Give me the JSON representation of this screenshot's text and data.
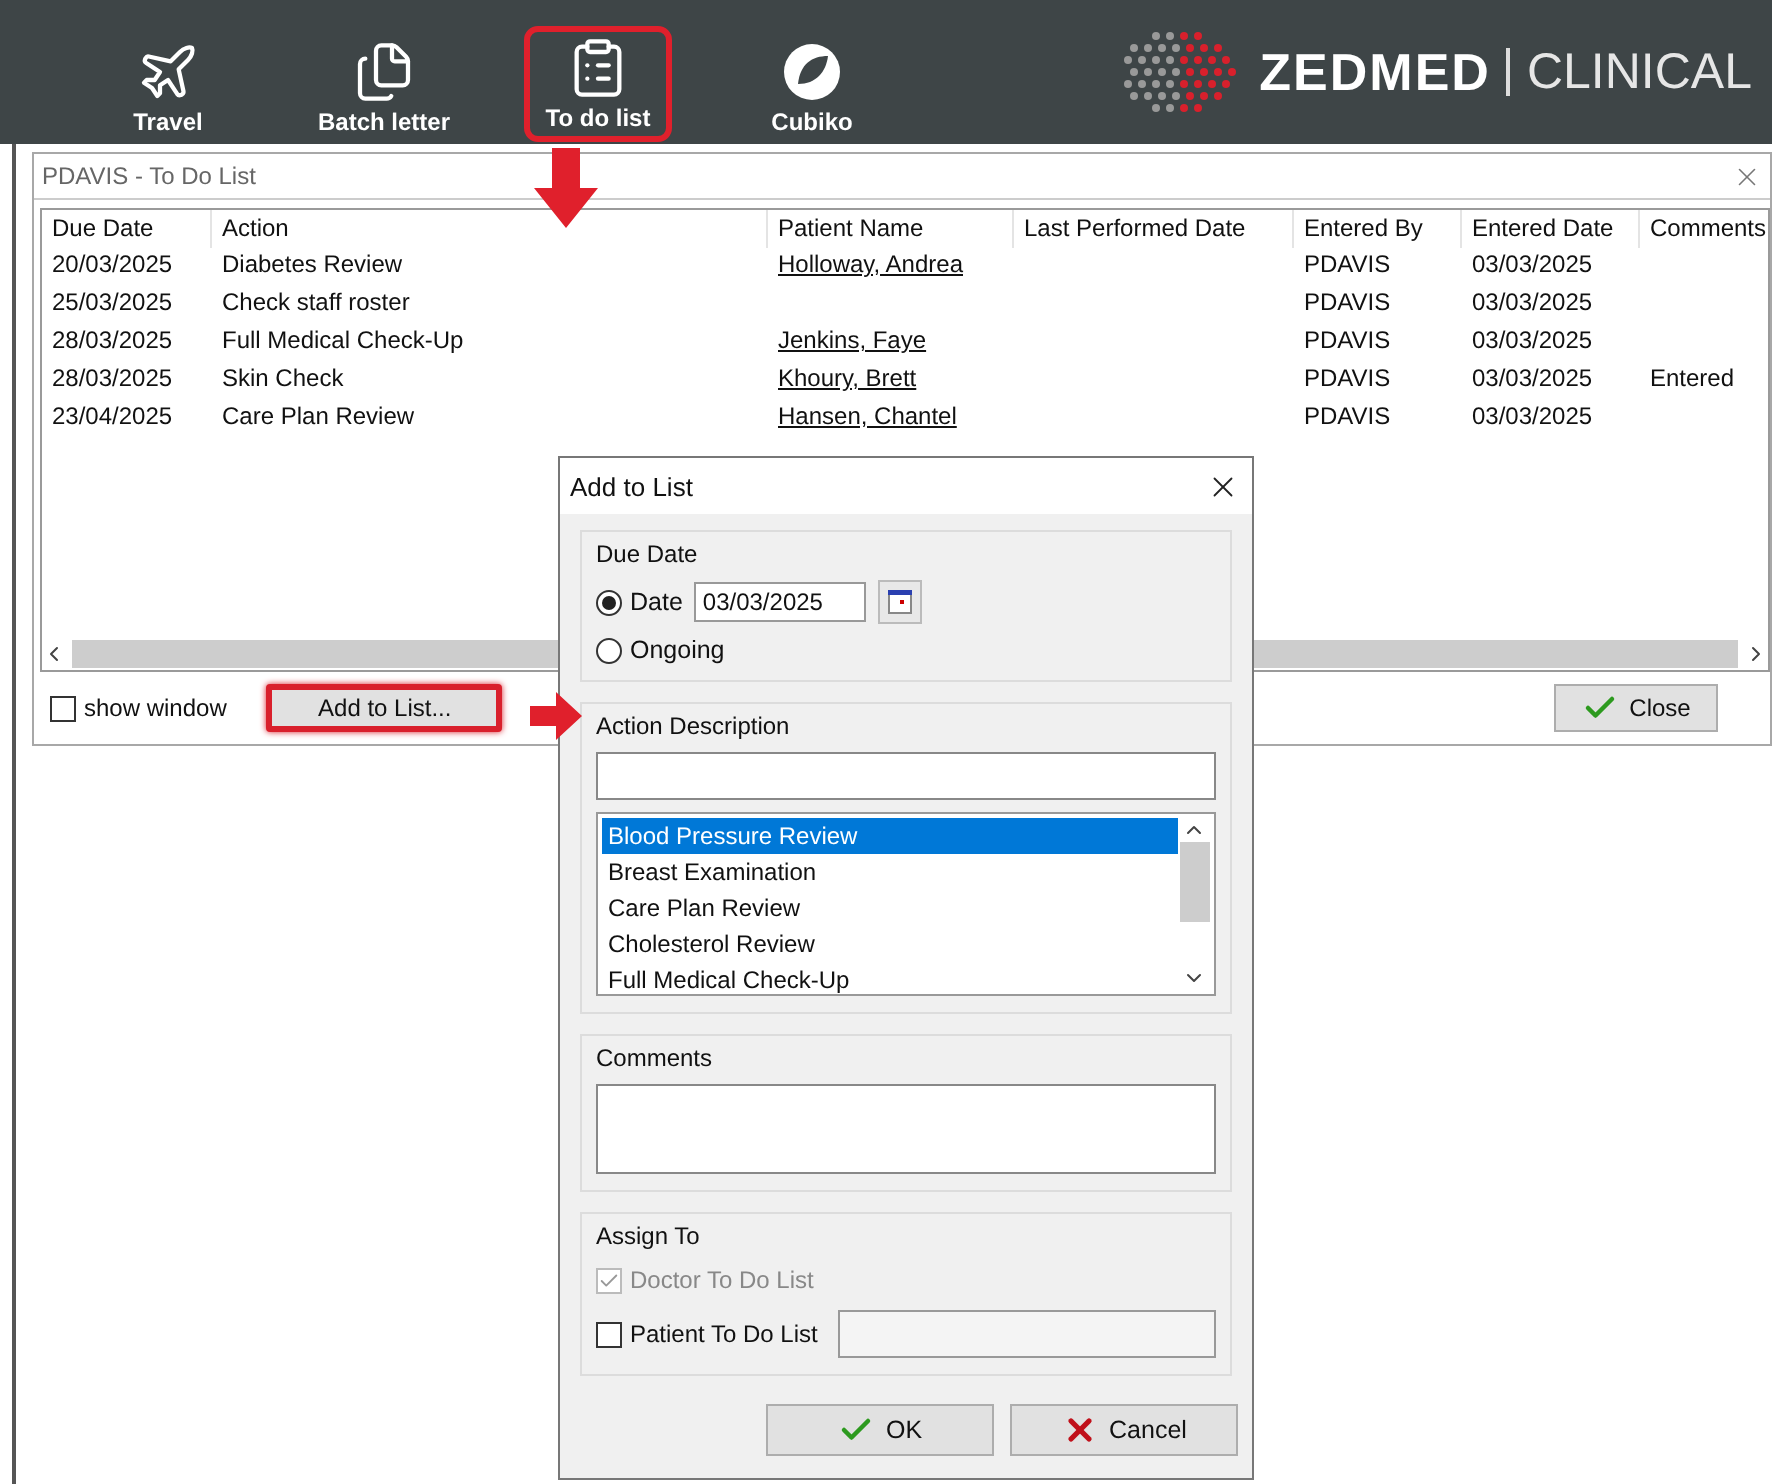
{
  "toolbar": {
    "buttons": [
      {
        "label": "Travel",
        "highlighted": false
      },
      {
        "label": "Batch letter",
        "highlighted": false
      },
      {
        "label": "To do list",
        "highlighted": true
      },
      {
        "label": "Cubiko",
        "highlighted": false
      }
    ],
    "logo": {
      "brand": "ZEDMED",
      "product": "CLINICAL"
    }
  },
  "window": {
    "title": "PDAVIS - To Do List"
  },
  "table": {
    "columns": [
      "Due Date",
      "Action",
      "Patient Name",
      "Last Performed Date",
      "Entered By",
      "Entered Date",
      "Comments"
    ],
    "rows": [
      {
        "due_date": "20/03/2025",
        "action": "Diabetes Review",
        "patient": "Holloway, Andrea",
        "entered_by": "PDAVIS",
        "entered_date": "03/03/2025"
      },
      {
        "due_date": "25/03/2025",
        "action": "Check staff roster",
        "entered_by": "PDAVIS",
        "entered_date": "03/03/2025"
      },
      {
        "due_date": "28/03/2025",
        "action": "Full Medical Check-Up",
        "patient": "Jenkins, Faye",
        "entered_by": "PDAVIS",
        "entered_date": "03/03/2025"
      },
      {
        "due_date": "28/03/2025",
        "action": "Skin Check",
        "patient": "Khoury, Brett",
        "entered_by": "PDAVIS",
        "entered_date": "03/03/2025",
        "comments": "Entered"
      },
      {
        "due_date": "23/04/2025",
        "action": "Care Plan Review",
        "patient": "Hansen, Chantel",
        "entered_by": "PDAVIS",
        "entered_date": "03/03/2025"
      }
    ]
  },
  "footer": {
    "show_window": {
      "label": "show window",
      "checked": false
    },
    "add_button": {
      "label": "Add to List...",
      "highlighted": true
    },
    "close_button": "Close"
  },
  "dialog": {
    "title": "Add to List",
    "due_date": {
      "legend": "Due Date",
      "options": [
        {
          "label": "Date",
          "selected": true,
          "value": "03/03/2025"
        },
        {
          "label": "Ongoing",
          "selected": false
        }
      ]
    },
    "action": {
      "legend": "Action Description",
      "items": [
        {
          "label": "Blood Pressure Review",
          "selected": true
        },
        {
          "label": "Breast Examination",
          "selected": false
        },
        {
          "label": "Care Plan Review",
          "selected": false
        },
        {
          "label": "Cholesterol Review",
          "selected": false
        },
        {
          "label": "Full Medical Check-Up",
          "selected": false
        }
      ]
    },
    "comments": {
      "legend": "Comments"
    },
    "assign": {
      "legend": "Assign To",
      "options": [
        {
          "label": "Doctor To Do List",
          "checked": true,
          "disabled": true,
          "field": false
        },
        {
          "label": "Patient To Do List",
          "checked": false,
          "disabled": false,
          "field": true
        }
      ]
    },
    "ok": "OK",
    "cancel": "Cancel"
  }
}
